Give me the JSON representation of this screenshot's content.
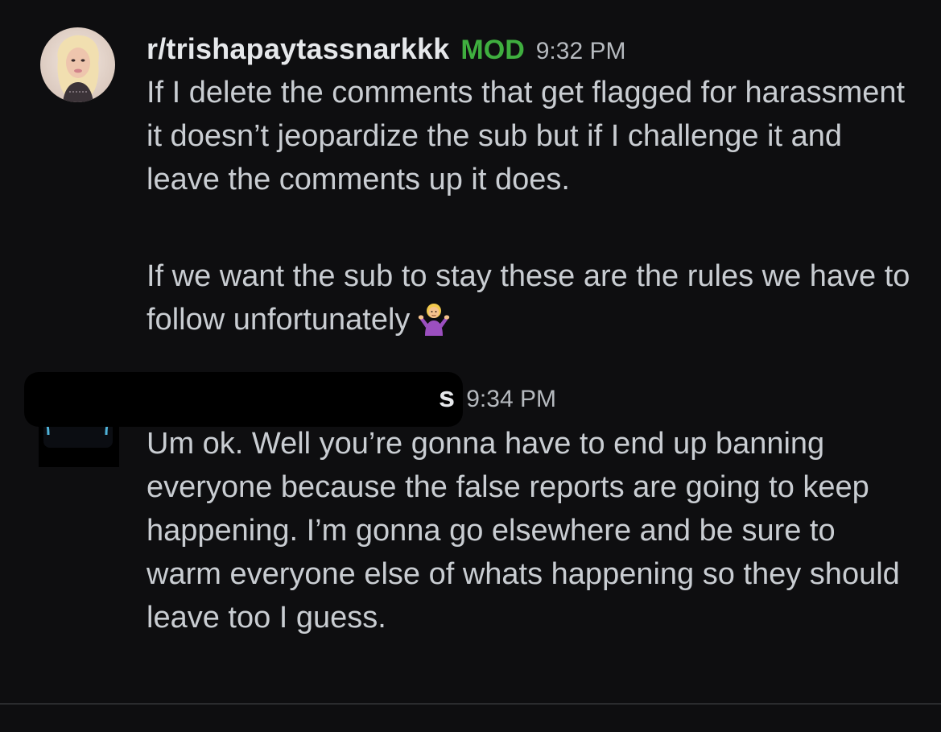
{
  "messages": [
    {
      "username": "r/trishapaytassnarkkk",
      "badge": "MOD",
      "time": "9:32 PM",
      "paragraphs": [
        "If I delete the comments that get flagged for harassment it doesn’t jeopardize the sub but if I challenge it and leave the comments up it does.",
        "If we want the sub to stay these are the rules we have to follow unfortunately"
      ],
      "emoji": "woman-shrugging-emoji"
    },
    {
      "username": "s",
      "time": "9:34 PM",
      "paragraphs": [
        "Um ok. Well you’re gonna have to end up banning everyone because the false reports are going to keep happening. I’m gonna go elsewhere and be sure to warm everyone else of whats happening so they should leave too I guess."
      ]
    }
  ],
  "colors": {
    "background": "#0e0e10",
    "text": "#c9cdd2",
    "username": "#e6e8eb",
    "mod_badge": "#3fae3f",
    "timestamp": "#b6babf"
  }
}
